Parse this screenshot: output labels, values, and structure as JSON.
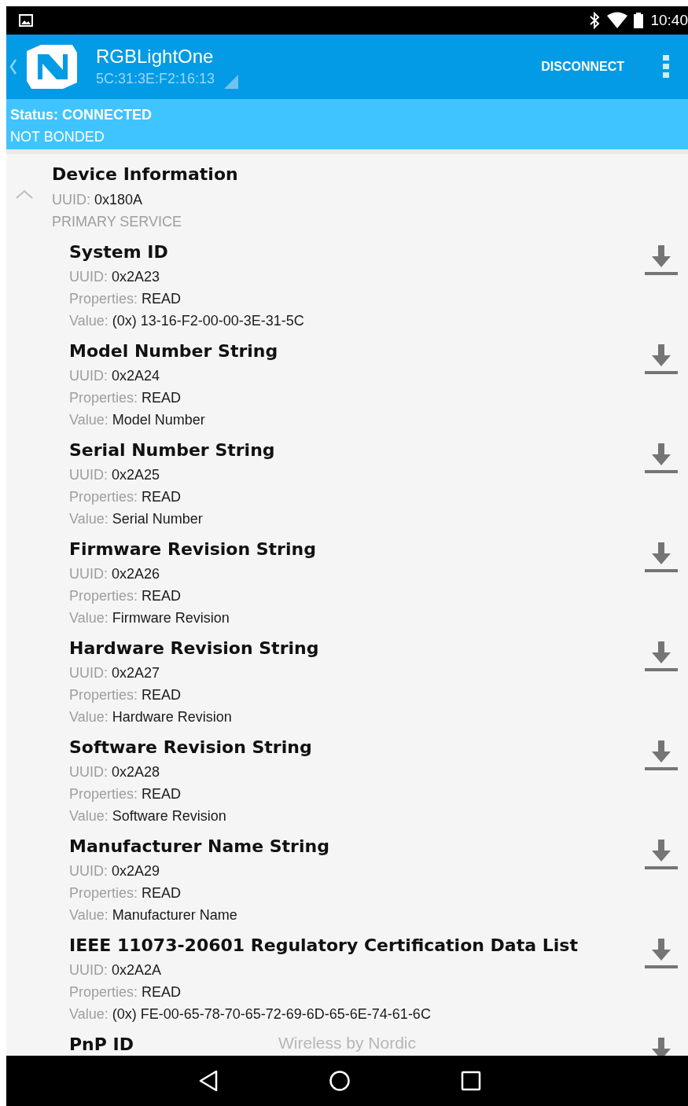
{
  "status_bar": {
    "time": "10:40"
  },
  "app_bar": {
    "device_name": "RGBLightOne",
    "address": "5C:31:3E:F2:16:13",
    "action": "DISCONNECT"
  },
  "connection": {
    "status": "Status: CONNECTED",
    "bond": "NOT BONDED"
  },
  "service": {
    "name": "Device Information",
    "uuid_label": "UUID:",
    "uuid": "0x180A",
    "type": "PRIMARY SERVICE",
    "expanded": true,
    "characteristics": [
      {
        "name": "System ID",
        "fields": [
          {
            "label": "UUID:",
            "value": "0x2A23"
          },
          {
            "label": "Properties:",
            "value": "READ"
          },
          {
            "label": "Value:",
            "value": "(0x) 13-16-F2-00-00-3E-31-5C"
          }
        ]
      },
      {
        "name": "Model Number String",
        "fields": [
          {
            "label": "UUID:",
            "value": "0x2A24"
          },
          {
            "label": "Properties:",
            "value": "READ"
          },
          {
            "label": "Value:",
            "value": "Model Number"
          }
        ]
      },
      {
        "name": "Serial Number String",
        "fields": [
          {
            "label": "UUID:",
            "value": "0x2A25"
          },
          {
            "label": "Properties:",
            "value": "READ"
          },
          {
            "label": "Value:",
            "value": "Serial Number"
          }
        ]
      },
      {
        "name": "Firmware Revision String",
        "fields": [
          {
            "label": "UUID:",
            "value": "0x2A26"
          },
          {
            "label": "Properties:",
            "value": "READ"
          },
          {
            "label": "Value:",
            "value": "Firmware Revision"
          }
        ]
      },
      {
        "name": "Hardware Revision String",
        "fields": [
          {
            "label": "UUID:",
            "value": "0x2A27"
          },
          {
            "label": "Properties:",
            "value": "READ"
          },
          {
            "label": "Value:",
            "value": "Hardware Revision"
          }
        ]
      },
      {
        "name": "Software Revision String",
        "fields": [
          {
            "label": "UUID:",
            "value": "0x2A28"
          },
          {
            "label": "Properties:",
            "value": "READ"
          },
          {
            "label": "Value:",
            "value": "Software Revision"
          }
        ]
      },
      {
        "name": "Manufacturer Name String",
        "fields": [
          {
            "label": "UUID:",
            "value": "0x2A29"
          },
          {
            "label": "Properties:",
            "value": "READ"
          },
          {
            "label": "Value:",
            "value": "Manufacturer Name"
          }
        ]
      },
      {
        "name": "IEEE 11073-20601 Regulatory Certification Data List",
        "fields": [
          {
            "label": "UUID:",
            "value": "0x2A2A"
          },
          {
            "label": "Properties:",
            "value": "READ"
          },
          {
            "label": "Value:",
            "value": "(0x) FE-00-65-78-70-65-72-69-6D-65-6E-74-61-6C"
          }
        ]
      },
      {
        "name": "PnP ID"
      }
    ]
  },
  "footer": "Wireless by Nordic"
}
